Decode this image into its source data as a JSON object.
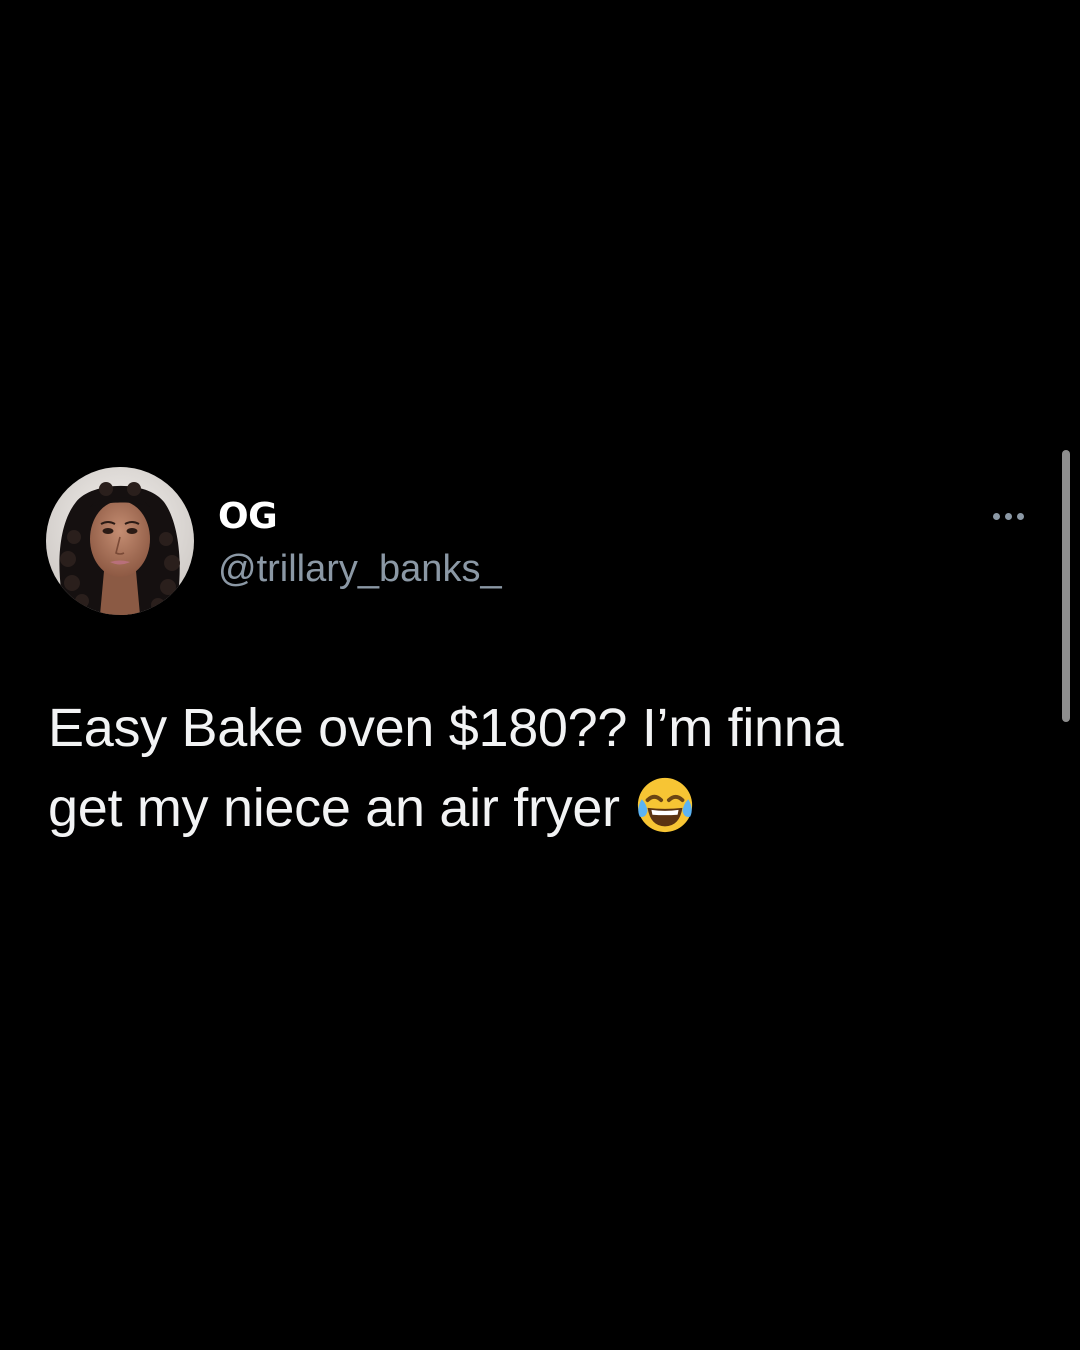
{
  "tweet": {
    "display_name": "OG",
    "handle": "@trillary_banks_",
    "text_line_1": "Easy Bake oven $180?? I’m finna",
    "text_line_2": "get my niece an air fryer",
    "emoji": "face-with-tears-of-joy-icon"
  },
  "icons": {
    "more": "more-horizontal-icon",
    "avatar": "profile-photo"
  },
  "colors": {
    "background": "#000000",
    "text": "#f2f3f4",
    "name": "#ffffff",
    "handle": "#8b98a5",
    "scrollbar": "#8e8e8e"
  }
}
